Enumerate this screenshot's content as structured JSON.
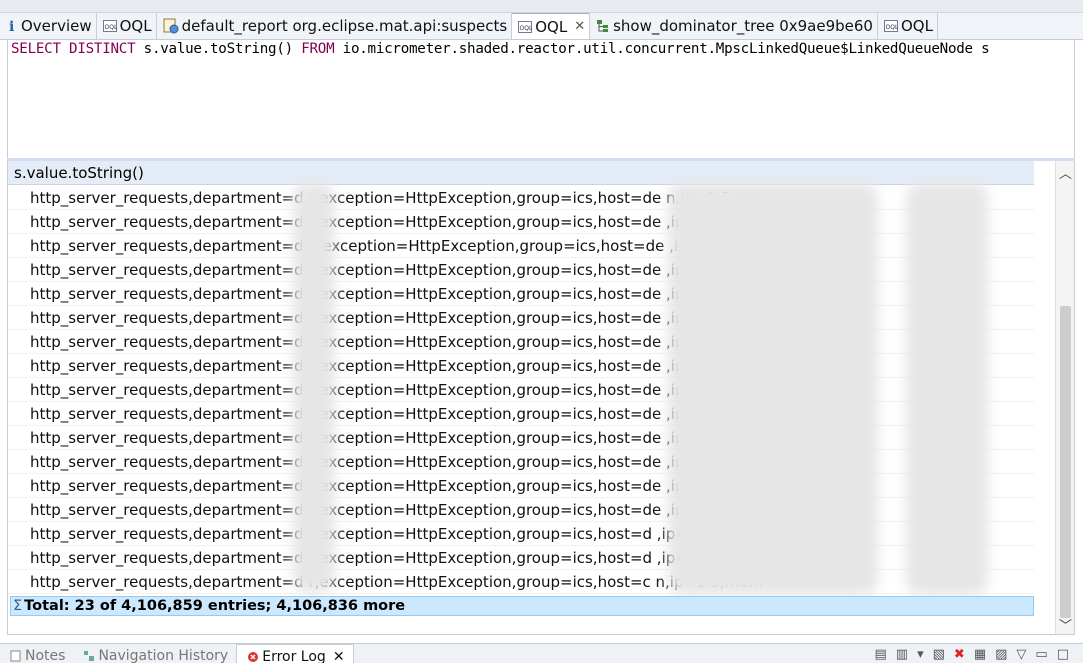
{
  "tabs": [
    {
      "label": "Overview",
      "icon": "info-icon",
      "active": false
    },
    {
      "label": "OQL",
      "icon": "oql-icon",
      "active": false
    },
    {
      "label": "default_report  org.eclipse.mat.api:suspects",
      "icon": "report-icon",
      "active": false
    },
    {
      "label": "OQL",
      "icon": "oql-icon",
      "active": true,
      "close": "✕"
    },
    {
      "label": "show_dominator_tree 0x9ae9be60",
      "icon": "tree-icon",
      "active": false
    },
    {
      "label": "OQL",
      "icon": "oql-icon",
      "active": false
    }
  ],
  "query": {
    "kw_select": "SELECT DISTINCT",
    "expr": " s.value.toString() ",
    "kw_from": "FROM",
    "target": " io.micrometer.shaded.reactor.util.concurrent.MpscLinkedQueue$LinkedQueueNode s"
  },
  "table": {
    "column_header": "s.value.toString()",
    "rows": [
      "http_server_requests,department=d     r,exception=HttpException,group=ics,host=de                              n,ip=1            5,me...",
      "http_server_requests,department=d     r,exception=HttpException,group=ics,host=de                                 ,ip=1            6,me...",
      "http_server_requests,department=de     ,exception=HttpException,group=ics,host=de                                 ,ip=1            5,me...",
      "http_server_requests,department=d     r,exception=HttpException,group=ics,host=de                                 ,ip=1            5,me...",
      "http_server_requests,department=d     r,exception=HttpException,group=ics,host=de                                 ,ip=1            5,me...",
      "http_server_requests,department=d     r,exception=HttpException,group=ics,host=de                                 ,ip=1            5,me...",
      "http_server_requests,department=d     r,exception=HttpException,group=ics,host=de                                 ,ip=1            5,me...",
      "http_server_requests,department=d     r,exception=HttpException,group=ics,host=de                                 ,ip=1            5,me...",
      "http_server_requests,department=d     r,exception=HttpException,group=ics,host=de                                 ,ip=1            6,me...",
      "http_server_requests,department=d     r,exception=HttpException,group=ics,host=de                                 ,ip=1            6,me...",
      "http_server_requests,department=d     r,exception=HttpException,group=ics,host=de                                 ,ip=1            6,me...",
      "http_server_requests,department=d     r,exception=HttpException,group=ics,host=de                                 ,ip=1            5,me...",
      "http_server_requests,department=d     r,exception=HttpException,group=ics,host=de                                 ,ip=1            5,me...",
      "http_server_requests,department=d     r,exception=HttpException,group=ics,host=de                                 ,ip=1            5,me...",
      "http_server_requests,department=d     r,exception=HttpException,group=ics,host=d                                  ,ip=1            5,me...",
      "http_server_requests,department=d     r,exception=HttpException,group=ics,host=d                                  ,ip=1            5,me...",
      "http_server_requests,department=d     r,exception=HttpException,group=ics,host=c                               n,ip=1            5,me..."
    ],
    "total": "Total: 23 of 4,106,859 entries; 4,106,836 more"
  },
  "bottom_tabs": [
    {
      "label": "Notes",
      "icon": "notes-icon",
      "active": false
    },
    {
      "label": "Navigation History",
      "icon": "history-icon",
      "active": false
    },
    {
      "label": "Error Log",
      "icon": "error-log-icon",
      "active": true,
      "close": "✕"
    }
  ],
  "colors": {
    "keyword": "#7f0055",
    "selection": "#cce8ff",
    "header": "#e4ecf7"
  }
}
